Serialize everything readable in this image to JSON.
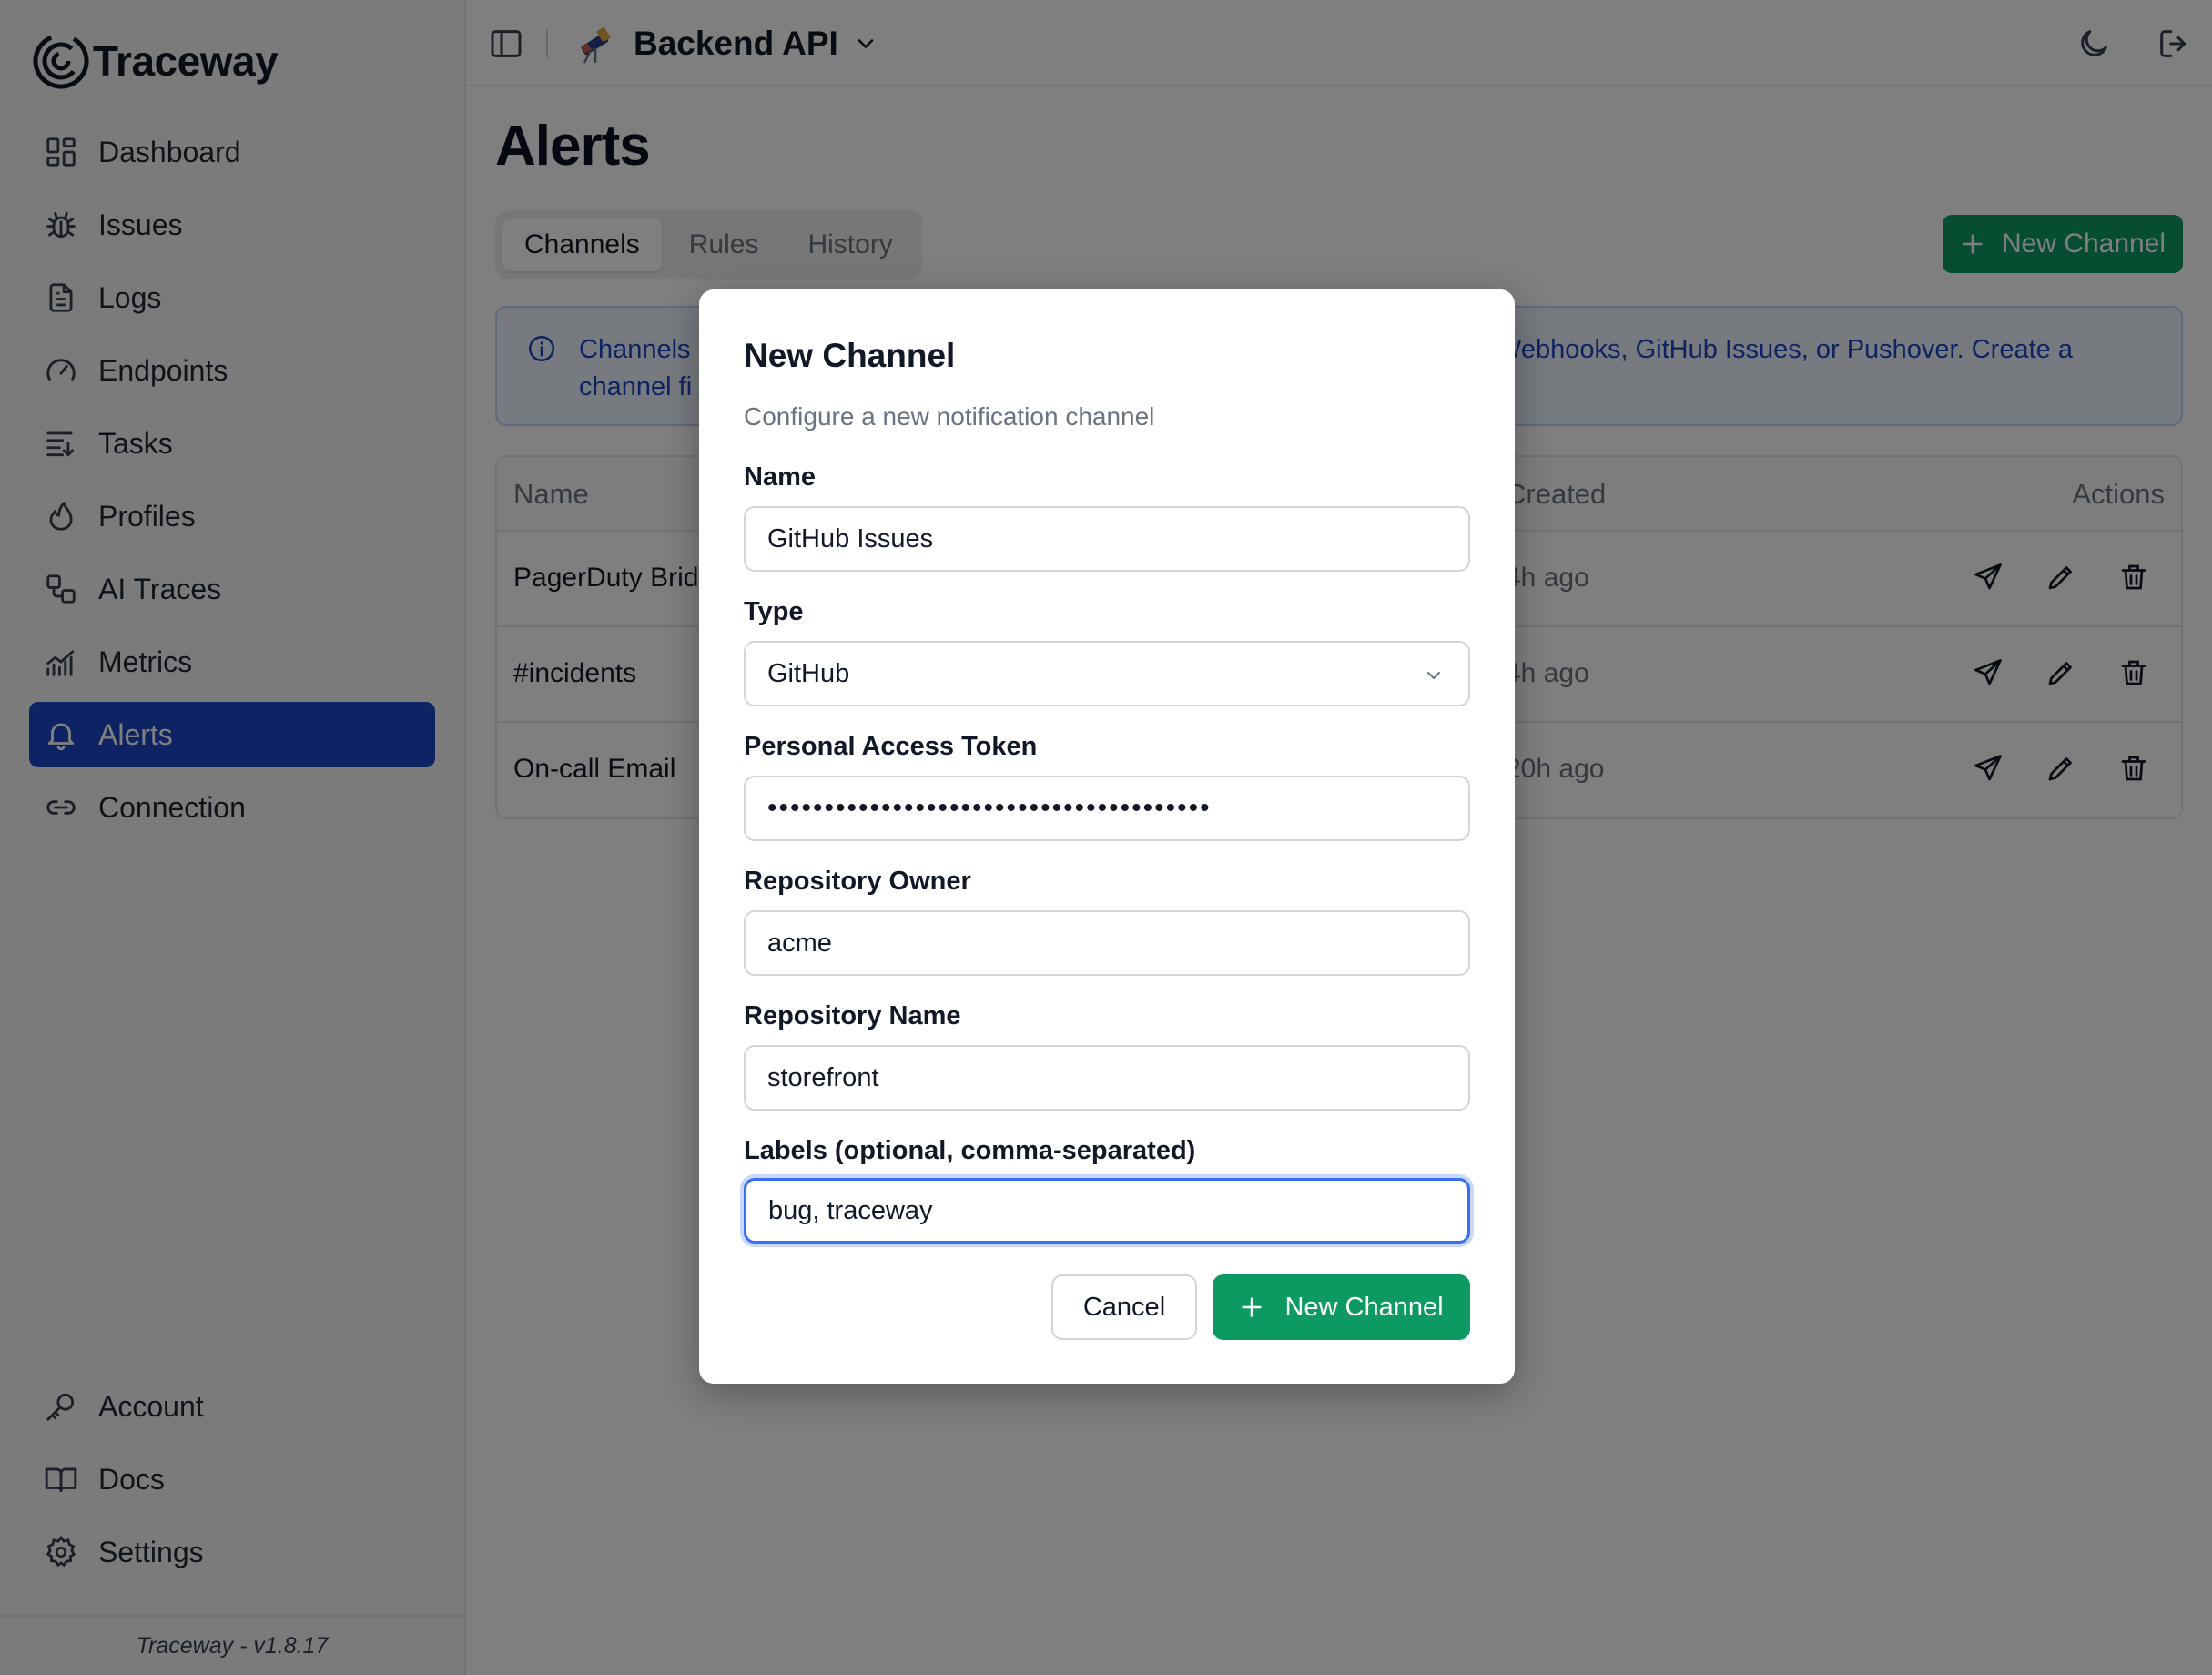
{
  "app": {
    "brand": "Traceway",
    "version": "Traceway - v1.8.17"
  },
  "colors": {
    "accent": "#1b46c8",
    "primary_button": "#0d9a62",
    "info_text": "#1b46c8"
  },
  "sidebar": {
    "items": [
      {
        "label": "Dashboard",
        "icon": "dashboard-icon"
      },
      {
        "label": "Issues",
        "icon": "bug-icon"
      },
      {
        "label": "Logs",
        "icon": "file-text-icon"
      },
      {
        "label": "Endpoints",
        "icon": "gauge-icon"
      },
      {
        "label": "Tasks",
        "icon": "list-icon"
      },
      {
        "label": "Profiles",
        "icon": "flame-icon"
      },
      {
        "label": "AI Traces",
        "icon": "workflow-icon"
      },
      {
        "label": "Metrics",
        "icon": "chart-icon"
      },
      {
        "label": "Alerts",
        "icon": "bell-icon"
      },
      {
        "label": "Connection",
        "icon": "link-icon"
      }
    ],
    "active": "Alerts",
    "bottom_items": [
      {
        "label": "Account",
        "icon": "key-icon"
      },
      {
        "label": "Docs",
        "icon": "book-icon"
      },
      {
        "label": "Settings",
        "icon": "gear-icon"
      }
    ]
  },
  "header": {
    "project_name": "Backend API",
    "project_icon": "telescope-icon"
  },
  "page": {
    "title": "Alerts",
    "tabs": [
      "Channels",
      "Rules",
      "History"
    ],
    "active_tab": "Channels",
    "new_channel_button": "New Channel",
    "info_left_line1": "Channels",
    "info_left_line2": "channel fi",
    "info_right": "Webhooks, GitHub Issues, or Pushover. Create a"
  },
  "table": {
    "headers": {
      "name": "Name",
      "created": "Created",
      "actions": "Actions"
    },
    "rows": [
      {
        "name": "PagerDuty Brid",
        "created": "4h ago"
      },
      {
        "name": "#incidents",
        "created": "4h ago"
      },
      {
        "name": "On-call Email",
        "created": "20h ago"
      }
    ]
  },
  "modal": {
    "title": "New Channel",
    "description": "Configure a new notification channel",
    "fields": {
      "name": {
        "label": "Name",
        "value": "GitHub Issues"
      },
      "type": {
        "label": "Type",
        "value": "GitHub"
      },
      "token": {
        "label": "Personal Access Token",
        "value": "•••••••••••••••••••••••••••••••••••••••"
      },
      "owner": {
        "label": "Repository Owner",
        "value": "acme"
      },
      "repo": {
        "label": "Repository Name",
        "value": "storefront"
      },
      "labels": {
        "label": "Labels (optional, comma-separated)",
        "value": "bug, traceway"
      }
    },
    "cancel_label": "Cancel",
    "submit_label": "New Channel"
  }
}
